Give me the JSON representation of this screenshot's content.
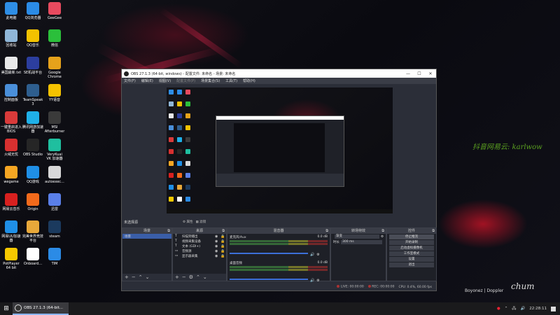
{
  "desktop": {
    "icons": [
      {
        "label": "此电脑",
        "color": "#2e8ee6"
      },
      {
        "label": "QQ浏览器",
        "color": "#2b8be6"
      },
      {
        "label": "GeeGee",
        "color": "#e84a5f"
      },
      {
        "label": "回收站",
        "color": "#8fb6d8"
      },
      {
        "label": "QQ音乐",
        "color": "#f2c200"
      },
      {
        "label": "微信",
        "color": "#2bbf3b"
      },
      {
        "label": "美国最新.txt",
        "color": "#e9e9e9"
      },
      {
        "label": "SE机战平台",
        "color": "#2c3e9e"
      },
      {
        "label": "Google Chrome",
        "color": "#e6a21b"
      },
      {
        "label": "控制面板",
        "color": "#4a8fd9"
      },
      {
        "label": "TeamSpeak 3",
        "color": "#2e5e8e"
      },
      {
        "label": "YY语音",
        "color": "#f5c200"
      },
      {
        "label": "一键重启进入BIOS",
        "color": "#d83a3a"
      },
      {
        "label": "腾讯网游加速器",
        "color": "#1fb0e8"
      },
      {
        "label": "MSI Afterburner",
        "color": "#3a3a3a"
      },
      {
        "label": "火绒无忧",
        "color": "#d83030"
      },
      {
        "label": "OBS Studio",
        "color": "#262626"
      },
      {
        "label": "VeryKuai VK 加速器",
        "color": "#1fbf9f"
      },
      {
        "label": "wegame",
        "color": "#f5a623"
      },
      {
        "label": "QQ游戏",
        "color": "#1f8fe6"
      },
      {
        "label": "autoexec...",
        "color": "#d8d8d8"
      },
      {
        "label": "网易云音乐",
        "color": "#d8201f"
      },
      {
        "label": "Origin",
        "color": "#f26a1b"
      },
      {
        "label": "迅雷",
        "color": "#5a7fe8"
      },
      {
        "label": "网易UU加速器",
        "color": "#1f8fe6"
      },
      {
        "label": "完美世界竞技平台",
        "color": "#e8a83a"
      },
      {
        "label": "steam",
        "color": "#1b3a5e"
      },
      {
        "label": "PotPlayer 64 bit",
        "color": "#f5c800"
      },
      {
        "label": "Onboard...",
        "color": "#ffffff"
      },
      {
        "label": "TIM",
        "color": "#2b8be6"
      }
    ],
    "watermark": "抖音网易云: karlwow",
    "signature": "Boyonez | Doppler"
  },
  "obs": {
    "title": "OBS 27.1.3 (64-bit, windows) - 配置文件: 未命名 - 场景: 未命名",
    "window_buttons": [
      "—",
      "☐",
      "✕"
    ],
    "menu": [
      "文件(F)",
      "编辑(E)",
      "视图(V)",
      "配置文件(P)",
      "场景集合(S)",
      "工具(T)",
      "帮助(H)"
    ],
    "scene_bar": {
      "label": "未选择源",
      "props": "⚙ 属性",
      "filters": "▦ 滤镜"
    },
    "scenes": {
      "title": "场景",
      "items": [
        "场景"
      ]
    },
    "sources": {
      "title": "来源",
      "items": [
        "扫描到播出",
        "视频采集设备",
        "文本 (GDI+)",
        "音频源",
        "显示器采集"
      ]
    },
    "mixer": {
      "title": "混音器",
      "channels": [
        {
          "name": "麦克风/Aux",
          "db": "0.0 dB"
        },
        {
          "name": "桌面音频",
          "db": "0.0 dB"
        }
      ]
    },
    "transitions": {
      "title": "转场特效",
      "type": "渐变",
      "duration_label": "时长",
      "duration": "300 ms"
    },
    "controls": {
      "title": "控件",
      "buttons": [
        "停止推流",
        "开始录制",
        "启动虚拟摄像机",
        "工作室模式",
        "设置",
        "退出"
      ]
    },
    "status": {
      "frames": "LIVE: 00:00:00",
      "rec": "REC: 00:00:00",
      "cpu": "CPU: 0.4%, 60.00 fps"
    }
  },
  "taskbar": {
    "task_label": "OBS 27.1.3 (64-bit...",
    "time": "22:28:11"
  }
}
